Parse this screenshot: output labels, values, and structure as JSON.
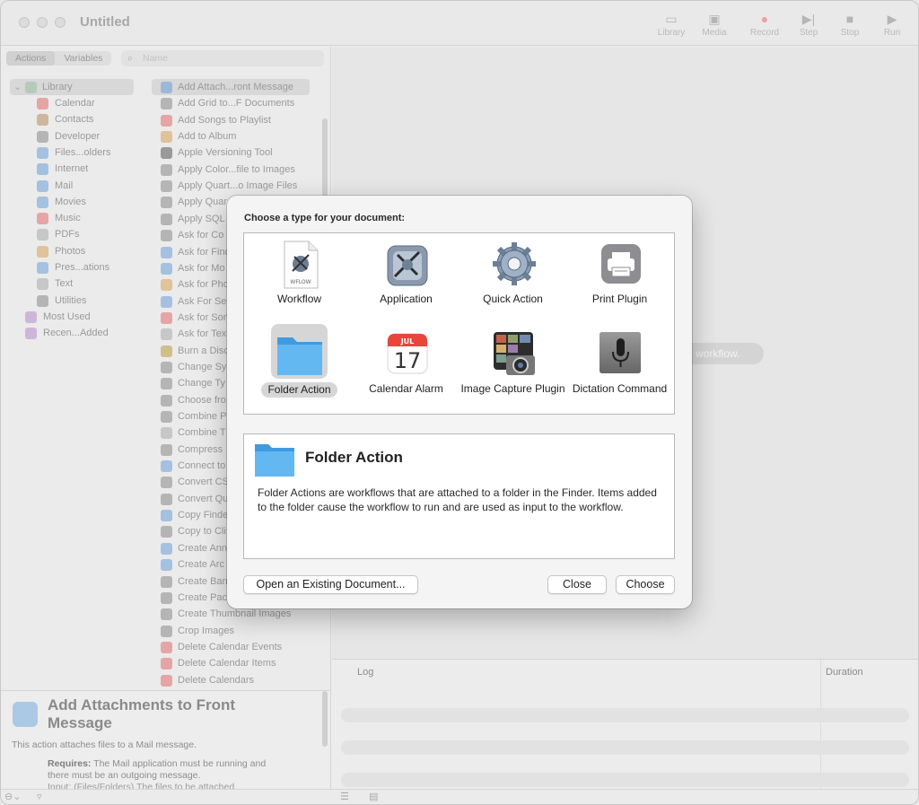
{
  "window": {
    "title": "Untitled"
  },
  "toolbar": {
    "library": "Library",
    "media": "Media",
    "record": "Record",
    "step": "Step",
    "stop": "Stop",
    "run": "Run",
    "accent_record": "#e0706a"
  },
  "left": {
    "tabs": [
      "Actions",
      "Variables"
    ],
    "search_placeholder": "Name",
    "library_root": "Library",
    "library_items": [
      "Calendar",
      "Contacts",
      "Developer",
      "Files...olders",
      "Internet",
      "Mail",
      "Movies",
      "Music",
      "PDFs",
      "Photos",
      "Pres...ations",
      "Text",
      "Utilities"
    ],
    "smart_groups": [
      "Most Used",
      "Recen...Added"
    ],
    "actions": [
      "Add Attach...ront Message",
      "Add Grid to...F Documents",
      "Add Songs to Playlist",
      "Add to Album",
      "Apple Versioning Tool",
      "Apply Color...file to Images",
      "Apply Quart...o Image Files",
      "Apply Quar",
      "Apply SQL",
      "Ask for Co",
      "Ask for Find",
      "Ask for Mo",
      "Ask for Pho",
      "Ask For Se",
      "Ask for Son",
      "Ask for Tex",
      "Burn a Disc",
      "Change Sy",
      "Change Ty",
      "Choose fro",
      "Combine P",
      "Combine T",
      "Compress",
      "Connect to",
      "Convert CS",
      "Convert Qu",
      "Copy Finde",
      "Copy to Cli",
      "Create Ann",
      "Create Arc",
      "Create Ban",
      "Create Pac",
      "Create Thumbnail Images",
      "Crop Images",
      "Delete Calendar Events",
      "Delete Calendar Items",
      "Delete Calendars"
    ]
  },
  "description": {
    "title": "Add Attachments to Front Message",
    "summary": "This action attaches files to a Mail message.",
    "requires_label": "Requires:",
    "requires_text": "The Mail application must be running and there must be an outgoing message.",
    "input_text": "Input: (Files/Folders) The files to be attached"
  },
  "workflow": {
    "hint": "or workflow.",
    "log_header": "Log",
    "duration_header": "Duration"
  },
  "dialog": {
    "title": "Choose a type for your document:",
    "types": [
      {
        "label": "Workflow",
        "icon": "workflow-document-icon"
      },
      {
        "label": "Application",
        "icon": "application-robot-icon"
      },
      {
        "label": "Quick Action",
        "icon": "gear-icon"
      },
      {
        "label": "Print Plugin",
        "icon": "printer-icon"
      },
      {
        "label": "Folder Action",
        "icon": "folder-icon",
        "selected": true
      },
      {
        "label": "Calendar Alarm",
        "icon": "calendar-icon"
      },
      {
        "label": "Image Capture Plugin",
        "icon": "camera-icon"
      },
      {
        "label": "Dictation Command",
        "icon": "microphone-icon"
      }
    ],
    "workflow_badge": "WFLOW",
    "calendar_month": "JUL",
    "calendar_day": "17",
    "selected_title": "Folder Action",
    "selected_description": "Folder Actions are workflows that are attached to a folder in the Finder. Items added to the folder cause the workflow to run and are used as input to the workflow.",
    "buttons": {
      "open_existing": "Open an Existing Document...",
      "close": "Close",
      "choose": "Choose"
    }
  },
  "colors": {
    "folder": "#5eb3ee",
    "calendar_red": "#e8453c",
    "selection": "#d6d6d6"
  }
}
